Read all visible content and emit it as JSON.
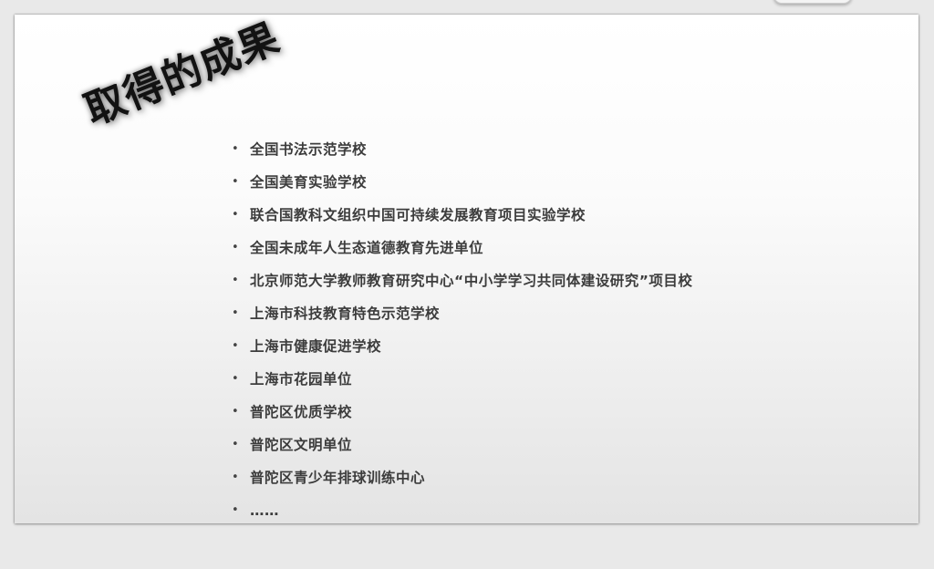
{
  "slide": {
    "title": "取得的成果",
    "bullet_glyph": "•",
    "items": [
      "全国书法示范学校",
      "全国美育实验学校",
      "联合国教科文组织中国可持续发展教育项目实验学校",
      "全国未成年人生态道德教育先进单位",
      "北京师范大学教师教育研究中心“中小学学习共同体建设研究”项目校",
      "上海市科技教育特色示范学校",
      "上海市健康促进学校",
      "上海市花园单位",
      "普陀区优质学校",
      "普陀区文明单位",
      "普陀区青少年排球训练中心",
      "……"
    ]
  }
}
